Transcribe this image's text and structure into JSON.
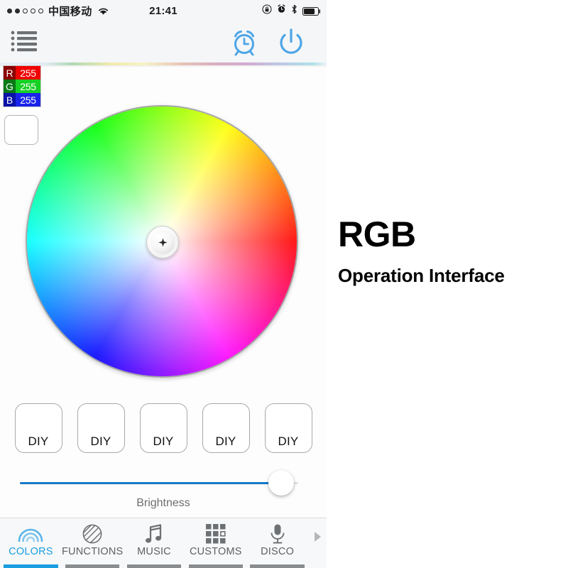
{
  "statusbar": {
    "signal_filled": 2,
    "signal_total": 5,
    "carrier": "中国移动",
    "wifi_icon": "wifi-icon",
    "time": "21:41",
    "icons": [
      "rotation-lock-icon",
      "alarm-icon",
      "bluetooth-icon",
      "battery-icon"
    ]
  },
  "toolbar": {
    "menu_icon": "list-menu-icon",
    "timer_icon": "alarm-clock-icon",
    "power_icon": "power-icon",
    "accent_color": "#4ea6e6"
  },
  "rgb_readout": {
    "rows": [
      {
        "channel": "R",
        "value": "255",
        "label_bg": "#8b0000",
        "value_bg": "#f00000"
      },
      {
        "channel": "G",
        "value": "255",
        "label_bg": "#0a7a16",
        "value_bg": "#18d024"
      },
      {
        "channel": "B",
        "value": "255",
        "label_bg": "#0a12a8",
        "value_bg": "#1a24e8"
      }
    ],
    "preview_color": "#ffffff"
  },
  "color_wheel": {
    "name": "hue-saturation-wheel",
    "picker_icon": "crosshair-icon",
    "picker_position": "center",
    "selected_color": "#ffffff"
  },
  "presets": {
    "buttons": [
      {
        "label": "DIY"
      },
      {
        "label": "DIY"
      },
      {
        "label": "DIY"
      },
      {
        "label": "DIY"
      },
      {
        "label": "DIY"
      }
    ]
  },
  "brightness": {
    "caption": "Brightness",
    "value": 94,
    "fill_color": "#1678c8"
  },
  "tabbar": {
    "tabs": [
      {
        "label": "COLORS",
        "icon": "rainbow-icon",
        "active": true
      },
      {
        "label": "FUNCTIONS",
        "icon": "hatched-circle-icon",
        "active": false
      },
      {
        "label": "MUSIC",
        "icon": "music-note-icon",
        "active": false
      },
      {
        "label": "CUSTOMS",
        "icon": "grid-icon",
        "active": false
      },
      {
        "label": "DISCO",
        "icon": "microphone-icon",
        "active": false
      }
    ],
    "more_icon": "chevron-right-icon",
    "active_color": "#1a9ee0",
    "inactive_color": "#5e6163"
  },
  "caption": {
    "title": "RGB",
    "subtitle": "Operation Interface"
  }
}
